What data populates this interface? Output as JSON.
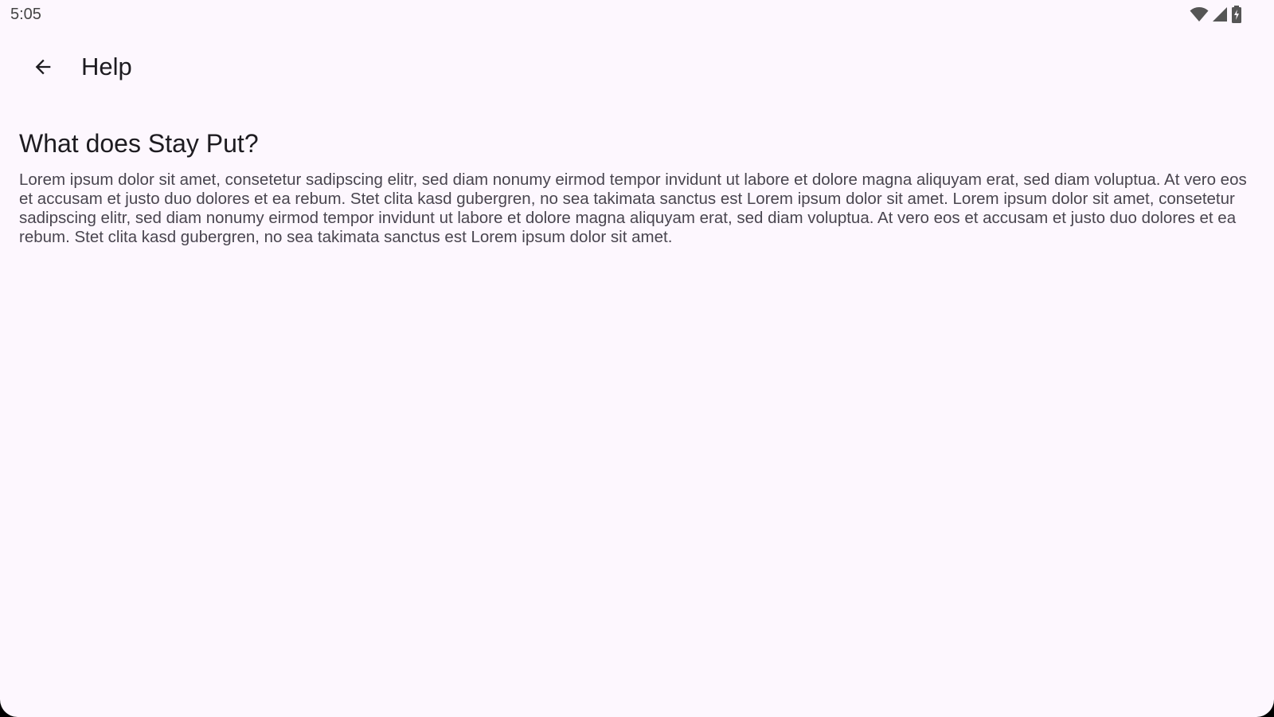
{
  "status_bar": {
    "time": "5:05",
    "icons": [
      "wifi-icon",
      "cell-signal-icon",
      "battery-charging-icon"
    ]
  },
  "app_bar": {
    "back_icon": "arrow-back-icon",
    "title": "Help"
  },
  "content": {
    "heading": "What does Stay Put?",
    "body": "Lorem ipsum dolor sit amet, consetetur sadipscing elitr, sed diam nonumy eirmod tempor invidunt ut labore et dolore magna aliquyam erat, sed diam voluptua. At vero eos et accusam et justo duo dolores et ea rebum. Stet clita kasd gubergren, no sea takimata sanctus est Lorem ipsum dolor sit amet. Lorem ipsum dolor sit amet, consetetur sadipscing elitr, sed diam nonumy eirmod tempor invidunt ut labore et dolore magna aliquyam erat, sed diam voluptua. At vero eos et accusam et justo duo dolores et ea rebum. Stet clita kasd gubergren, no sea takimata sanctus est Lorem ipsum dolor sit amet."
  },
  "colors": {
    "background": "#FDF7FE",
    "title_text": "#1D1B20",
    "body_text": "#49454F",
    "status_icons": "#555555"
  }
}
